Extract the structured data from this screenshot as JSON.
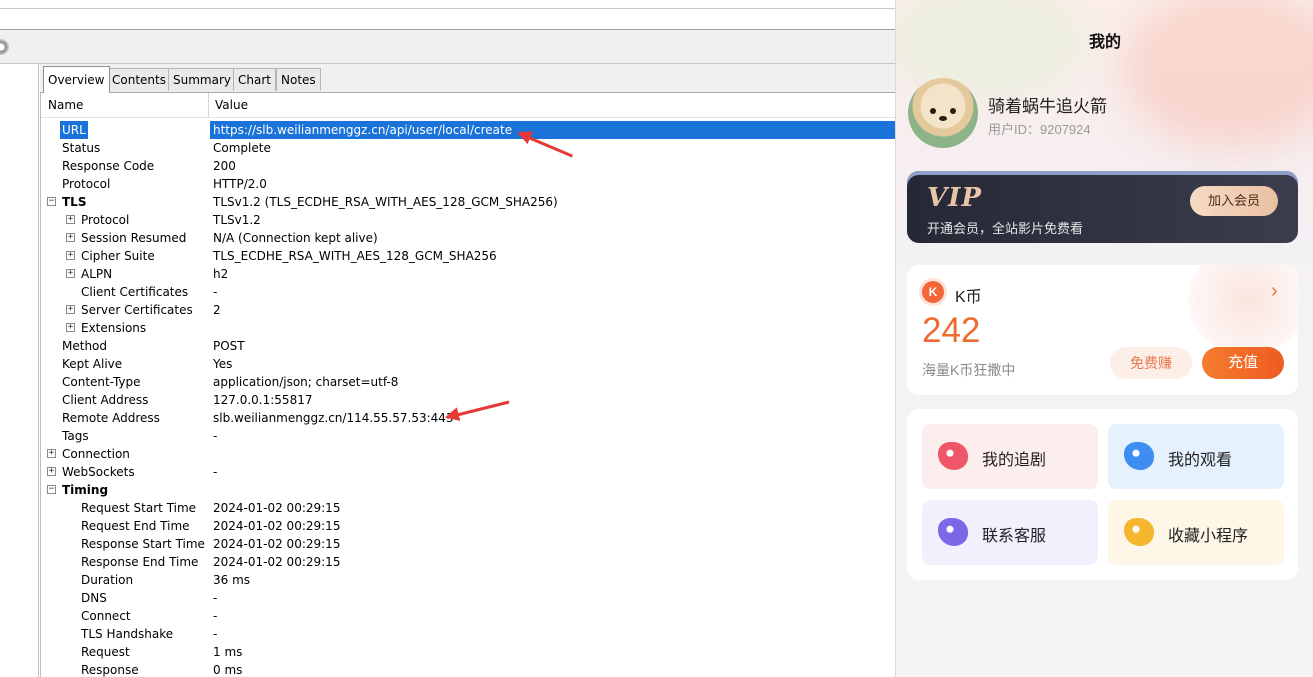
{
  "inspector": {
    "tabs": [
      "Overview",
      "Contents",
      "Summary",
      "Chart",
      "Notes"
    ],
    "active_tab": "Overview",
    "columns": {
      "name": "Name",
      "value": "Value"
    },
    "rows": [
      {
        "name": "URL",
        "value": "https://slb.weilianmenggz.cn/api/user/local/create",
        "expander": "none"
      },
      {
        "name": "Status",
        "value": "Complete",
        "expander": "none"
      },
      {
        "name": "Response Code",
        "value": "200",
        "expander": "none"
      },
      {
        "name": "Protocol",
        "value": "HTTP/2.0",
        "expander": "none"
      },
      {
        "name": "TLS",
        "value": "TLSv1.2 (TLS_ECDHE_RSA_WITH_AES_128_GCM_SHA256)",
        "expander": "collapse"
      },
      {
        "name": "Protocol",
        "value": "TLSv1.2",
        "expander": "expand"
      },
      {
        "name": "Session Resumed",
        "value": "N/A (Connection kept alive)",
        "expander": "expand"
      },
      {
        "name": "Cipher Suite",
        "value": "TLS_ECDHE_RSA_WITH_AES_128_GCM_SHA256",
        "expander": "expand"
      },
      {
        "name": "ALPN",
        "value": "h2",
        "expander": "expand"
      },
      {
        "name": "Client Certificates",
        "value": "-",
        "expander": "none"
      },
      {
        "name": "Server Certificates",
        "value": "2",
        "expander": "expand"
      },
      {
        "name": "Extensions",
        "value": "",
        "expander": "expand"
      },
      {
        "name": "Method",
        "value": "POST",
        "expander": "none"
      },
      {
        "name": "Kept Alive",
        "value": "Yes",
        "expander": "none"
      },
      {
        "name": "Content-Type",
        "value": "application/json; charset=utf-8",
        "expander": "none"
      },
      {
        "name": "Client Address",
        "value": "127.0.0.1:55817",
        "expander": "none"
      },
      {
        "name": "Remote Address",
        "value": "slb.weilianmenggz.cn/114.55.57.53:443",
        "expander": "none"
      },
      {
        "name": "Tags",
        "value": "-",
        "expander": "none"
      },
      {
        "name": "Connection",
        "value": "",
        "expander": "expand"
      },
      {
        "name": "WebSockets",
        "value": "-",
        "expander": "expand"
      },
      {
        "name": "Timing",
        "value": "",
        "expander": "collapse"
      },
      {
        "name": "Request Start Time",
        "value": "2024-01-02 00:29:15",
        "expander": "none"
      },
      {
        "name": "Request End Time",
        "value": "2024-01-02 00:29:15",
        "expander": "none"
      },
      {
        "name": "Response Start Time",
        "value": "2024-01-02 00:29:15",
        "expander": "none"
      },
      {
        "name": "Response End Time",
        "value": "2024-01-02 00:29:15",
        "expander": "none"
      },
      {
        "name": "Duration",
        "value": "36 ms",
        "expander": "none"
      },
      {
        "name": "DNS",
        "value": "-",
        "expander": "none"
      },
      {
        "name": "Connect",
        "value": "-",
        "expander": "none"
      },
      {
        "name": "TLS Handshake",
        "value": "-",
        "expander": "none"
      },
      {
        "name": "Request",
        "value": "1 ms",
        "expander": "none"
      },
      {
        "name": "Response",
        "value": "0 ms",
        "expander": "none"
      }
    ],
    "selection_color": "#1a73d9",
    "annotation_color": "#e53a36"
  },
  "app": {
    "title": "我的",
    "user": {
      "name": "骑着蜗牛追火箭",
      "id_label": "用户ID：9207924"
    },
    "vip": {
      "logo": "VIP",
      "subtitle": "开通会员，全站影片免费看",
      "button": "加入会员"
    },
    "coins": {
      "icon": "K",
      "label": "K币",
      "value": "242",
      "subtitle": "海量K币狂撒中",
      "free_button": "免费赚",
      "charge_button": "充值",
      "chevron": "›"
    },
    "tiles": [
      {
        "label": "我的追剧",
        "icon": "heart-icon",
        "bg": "#fdeeee",
        "icon_color": "#f0566a"
      },
      {
        "label": "我的观看",
        "icon": "tv-icon",
        "bg": "#e6f1fe",
        "icon_color": "#3d8ef0"
      },
      {
        "label": "联系客服",
        "icon": "headset-icon",
        "bg": "#f2f0fd",
        "icon_color": "#7a68e9"
      },
      {
        "label": "收藏小程序",
        "icon": "star-icon",
        "bg": "#fef7e8",
        "icon_color": "#f6b730"
      }
    ]
  }
}
